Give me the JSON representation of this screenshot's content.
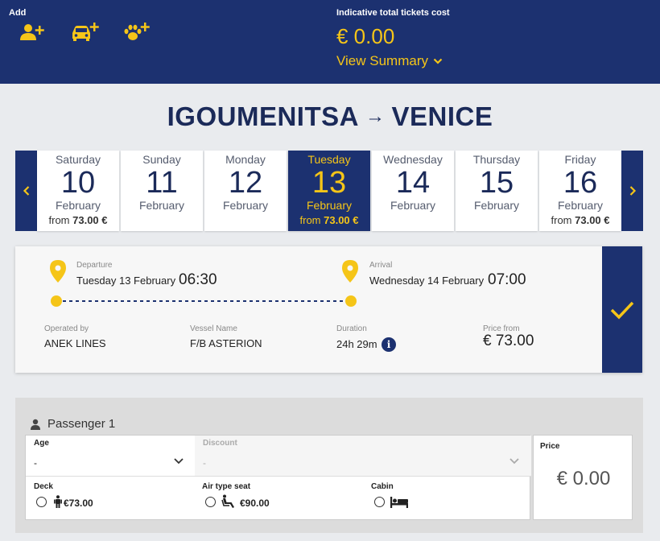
{
  "header": {
    "add_label": "Add",
    "cost_label": "Indicative total tickets cost",
    "cost_value": "€ 0.00",
    "view_summary": "View Summary",
    "add_icons": [
      "add-passenger-icon",
      "add-vehicle-icon",
      "add-pet-icon"
    ]
  },
  "route": {
    "from": "IGOUMENITSA",
    "arrow": "→",
    "to": "VENICE"
  },
  "dates": [
    {
      "weekday": "Saturday",
      "day": "10",
      "month": "February",
      "from_label": "from",
      "price": "73.00 €",
      "active": false
    },
    {
      "weekday": "Sunday",
      "day": "11",
      "month": "February",
      "from_label": "",
      "price": "",
      "active": false
    },
    {
      "weekday": "Monday",
      "day": "12",
      "month": "February",
      "from_label": "",
      "price": "",
      "active": false
    },
    {
      "weekday": "Tuesday",
      "day": "13",
      "month": "February",
      "from_label": "from",
      "price": "73.00 €",
      "active": true
    },
    {
      "weekday": "Wednesday",
      "day": "14",
      "month": "February",
      "from_label": "",
      "price": "",
      "active": false
    },
    {
      "weekday": "Thursday",
      "day": "15",
      "month": "February",
      "from_label": "",
      "price": "",
      "active": false
    },
    {
      "weekday": "Friday",
      "day": "16",
      "month": "February",
      "from_label": "from",
      "price": "73.00 €",
      "active": false
    }
  ],
  "trip": {
    "departure_label": "Departure",
    "departure_date": "Tuesday 13 February",
    "departure_time": "06:30",
    "arrival_label": "Arrival",
    "arrival_date": "Wednesday 14 February",
    "arrival_time": "07:00",
    "operator_label": "Operated by",
    "operator": "ANEK LINES",
    "vessel_label": "Vessel Name",
    "vessel": "F/B ASTERION",
    "duration_label": "Duration",
    "duration": "24h 29m",
    "price_label": "Price from",
    "price": "€ 73.00"
  },
  "passenger": {
    "title": "Passenger 1",
    "age_label": "Age",
    "age_value": "-",
    "discount_label": "Discount",
    "discount_value": "-",
    "deck_label": "Deck",
    "deck_price": "€73.00",
    "seat_label": "Air type seat",
    "seat_price": "€90.00",
    "cabin_label": "Cabin",
    "price_label": "Price",
    "price_value": "€ 0.00"
  },
  "colors": {
    "navy": "#1c3170",
    "accent": "#f5c518"
  }
}
